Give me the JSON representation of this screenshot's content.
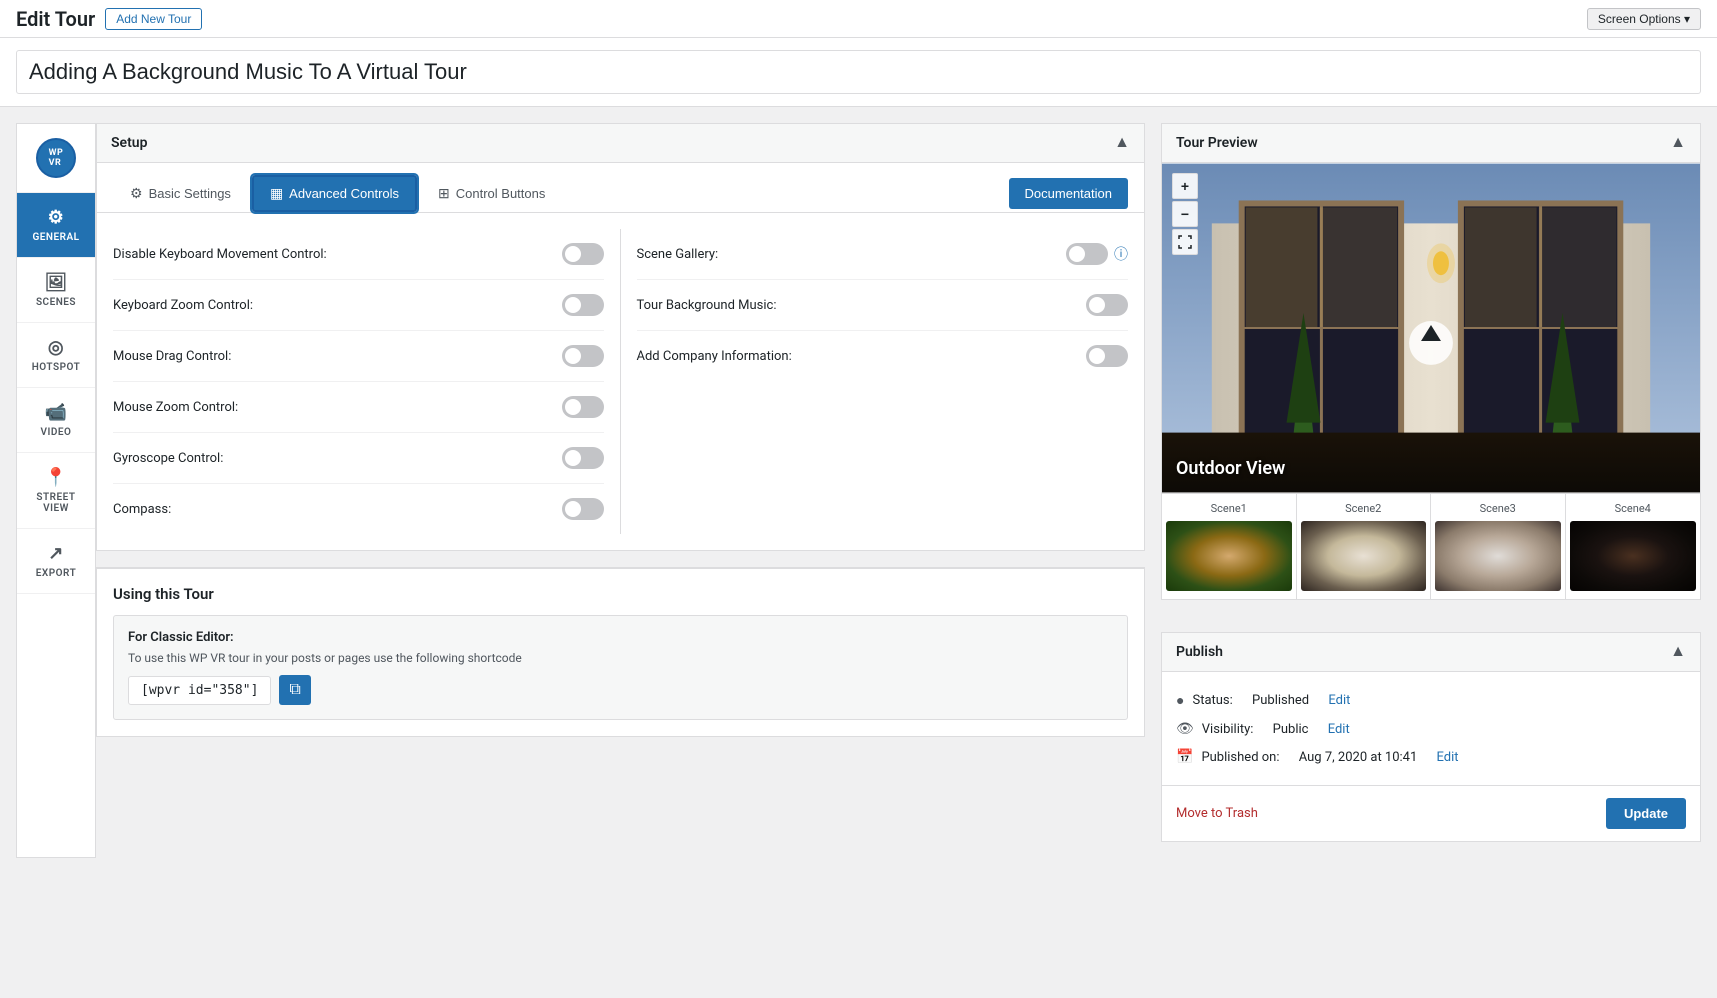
{
  "topBar": {
    "pageTitle": "Edit Tour",
    "addNewLabel": "Add New Tour",
    "screenOptions": "Screen Options ▾"
  },
  "titleInput": {
    "value": "Adding A Background Music To A Virtual Tour"
  },
  "setupPanel": {
    "title": "Setup",
    "collapseIcon": "▲"
  },
  "tabs": [
    {
      "id": "basic",
      "label": "Basic Settings",
      "icon": "⚙",
      "active": false
    },
    {
      "id": "advanced",
      "label": "Advanced Controls",
      "icon": "▦",
      "active": true
    },
    {
      "id": "control",
      "label": "Control Buttons",
      "icon": "⊞",
      "active": false
    }
  ],
  "documentationBtn": "Documentation",
  "controls": {
    "left": [
      {
        "id": "disable-keyboard",
        "label": "Disable Keyboard Movement Control:",
        "checked": false
      },
      {
        "id": "keyboard-zoom",
        "label": "Keyboard Zoom Control:",
        "checked": false
      },
      {
        "id": "mouse-drag",
        "label": "Mouse Drag Control:",
        "checked": false
      },
      {
        "id": "mouse-zoom",
        "label": "Mouse Zoom Control:",
        "checked": false
      },
      {
        "id": "gyroscope",
        "label": "Gyroscope Control:",
        "checked": false
      },
      {
        "id": "compass",
        "label": "Compass:",
        "checked": false
      }
    ],
    "right": [
      {
        "id": "scene-gallery",
        "label": "Scene Gallery:",
        "checked": false,
        "hasInfo": true
      },
      {
        "id": "tour-bg-music",
        "label": "Tour Background Music:",
        "checked": false,
        "hasInfo": false
      },
      {
        "id": "add-company",
        "label": "Add Company Information:",
        "checked": false,
        "hasInfo": false
      }
    ]
  },
  "usingSection": {
    "title": "Using this Tour",
    "classicEditorLabel": "For Classic Editor:",
    "classicEditorDesc": "To use this WP VR tour in your posts or pages use the following shortcode",
    "shortcode": "[wpvr id=\"358\"]",
    "copyIcon": "⧉"
  },
  "tourPreview": {
    "title": "Tour Preview",
    "collapseIcon": "▲",
    "zoomIn": "+",
    "zoomOut": "−",
    "fullscreen": "⛶",
    "sceneLabel": "Outdoor View",
    "scenes": [
      {
        "id": "scene1",
        "label": "Scene1"
      },
      {
        "id": "scene2",
        "label": "Scene2"
      },
      {
        "id": "scene3",
        "label": "Scene3"
      },
      {
        "id": "scene4",
        "label": "Scene4"
      }
    ]
  },
  "publish": {
    "title": "Publish",
    "collapseIcon": "▲",
    "statusLabel": "Status:",
    "statusValue": "Published",
    "statusEdit": "Edit",
    "visibilityLabel": "Visibility:",
    "visibilityValue": "Public",
    "visibilityEdit": "Edit",
    "publishedLabel": "Published on:",
    "publishedValue": "Aug 7, 2020 at 10:41",
    "publishedEdit": "Edit",
    "moveToTrash": "Move to Trash",
    "updateBtn": "Update"
  },
  "sidebar": {
    "logoText": "WP VR",
    "items": [
      {
        "id": "general",
        "label": "GENERAL",
        "icon": "⚙",
        "active": true
      },
      {
        "id": "scenes",
        "label": "SCENES",
        "icon": "🖼",
        "active": false
      },
      {
        "id": "hotspot",
        "label": "HOTSPOT",
        "icon": "◎",
        "active": false
      },
      {
        "id": "video",
        "label": "VIDEO",
        "icon": "📹",
        "active": false
      },
      {
        "id": "street-view",
        "label": "STREET VIEW",
        "icon": "📍",
        "active": false
      },
      {
        "id": "export",
        "label": "EXPORT",
        "icon": "↗",
        "active": false
      }
    ]
  }
}
